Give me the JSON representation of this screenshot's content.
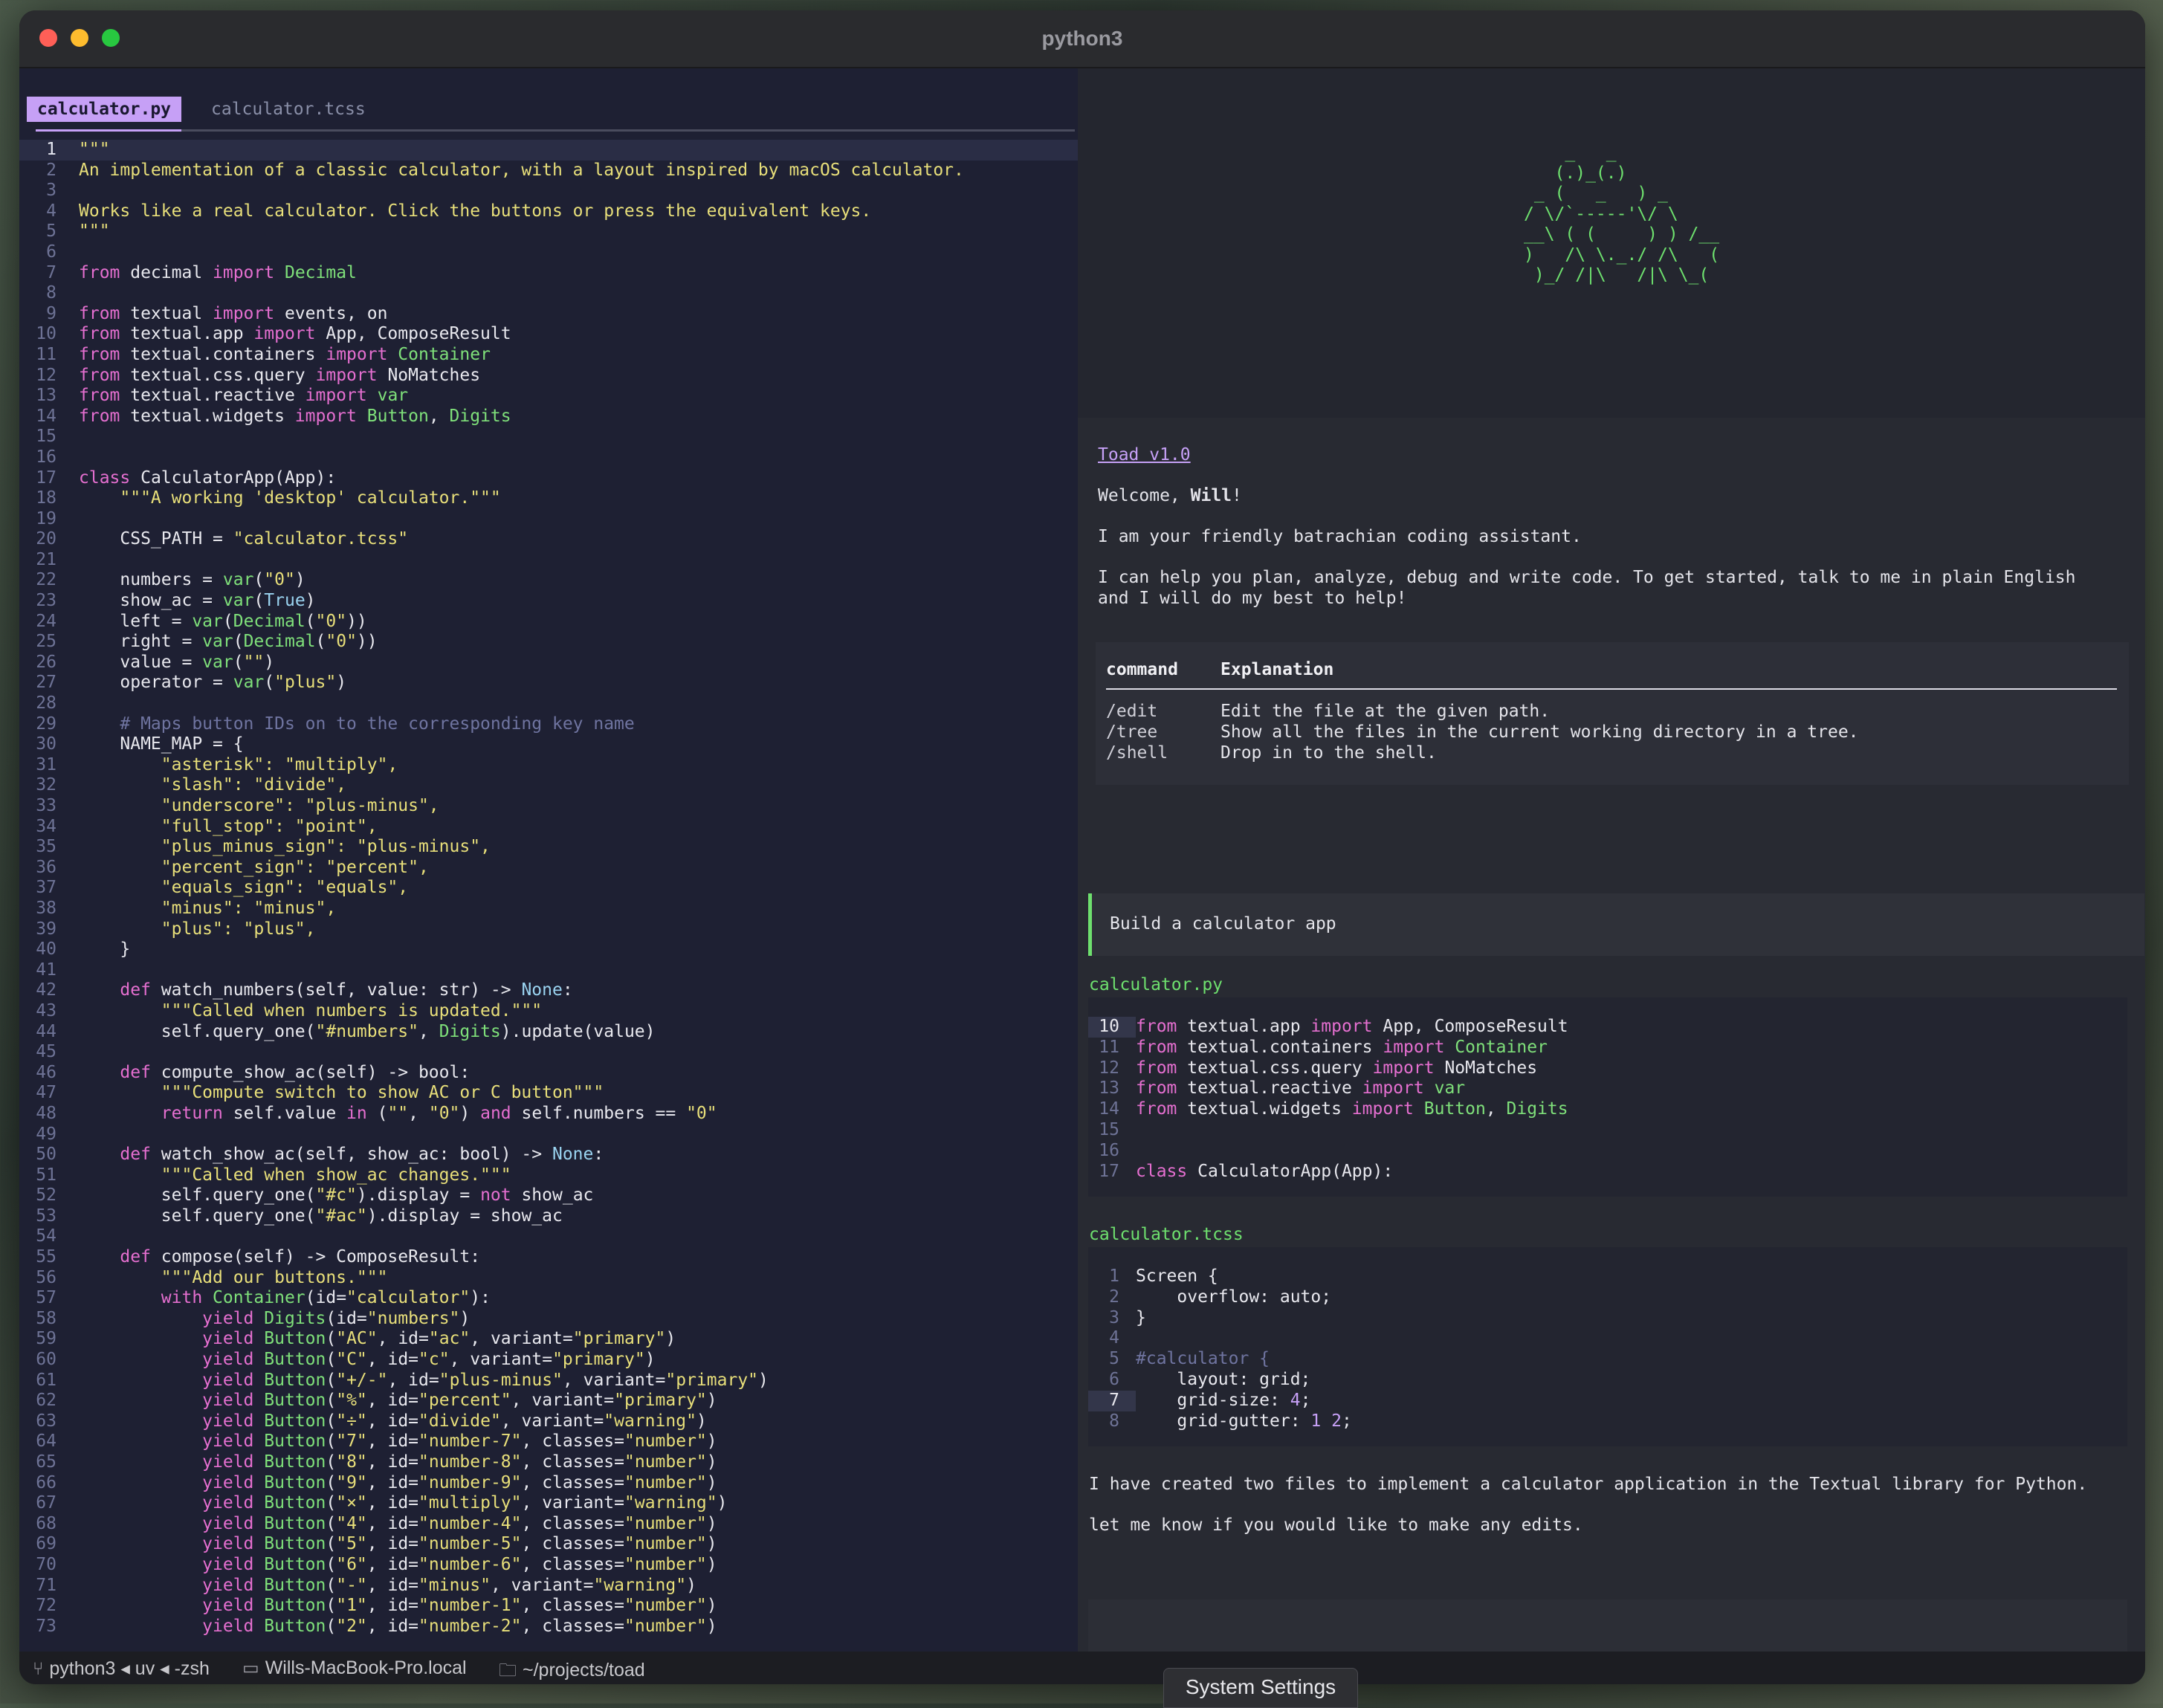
{
  "window": {
    "title": "python3"
  },
  "editor": {
    "tabs": [
      {
        "label": "calculator.py",
        "active": true
      },
      {
        "label": "calculator.tcss",
        "active": false
      }
    ],
    "lines": [
      {
        "n": "1",
        "t": "\"\"\"",
        "cls": "s"
      },
      {
        "n": "2",
        "t": "An implementation of a classic calculator, with a layout inspired by macOS calculator.",
        "cls": "s"
      },
      {
        "n": "3",
        "t": "",
        "cls": "s"
      },
      {
        "n": "4",
        "t": "Works like a real calculator. Click the buttons or press the equivalent keys.",
        "cls": "s"
      },
      {
        "n": "5",
        "t": "\"\"\"",
        "cls": "s"
      },
      {
        "n": "6",
        "t": "",
        "cls": ""
      },
      {
        "n": "7",
        "t": "from decimal import Decimal",
        "cls": "imp"
      },
      {
        "n": "8",
        "t": "",
        "cls": ""
      },
      {
        "n": "9",
        "t": "from textual import events, on",
        "cls": "imp"
      },
      {
        "n": "10",
        "t": "from textual.app import App, ComposeResult",
        "cls": "imp"
      },
      {
        "n": "11",
        "t": "from textual.containers import Container",
        "cls": "imp"
      },
      {
        "n": "12",
        "t": "from textual.css.query import NoMatches",
        "cls": "imp"
      },
      {
        "n": "13",
        "t": "from textual.reactive import var",
        "cls": "imp"
      },
      {
        "n": "14",
        "t": "from textual.widgets import Button, Digits",
        "cls": "imp"
      },
      {
        "n": "15",
        "t": "",
        "cls": ""
      },
      {
        "n": "16",
        "t": "",
        "cls": ""
      },
      {
        "n": "17",
        "t": "class CalculatorApp(App):",
        "cls": ""
      },
      {
        "n": "18",
        "t": "    \"\"\"A working 'desktop' calculator.\"\"\"",
        "cls": "s"
      },
      {
        "n": "19",
        "t": "",
        "cls": ""
      },
      {
        "n": "20",
        "t": "    CSS_PATH = \"calculator.tcss\"",
        "cls": ""
      },
      {
        "n": "21",
        "t": "",
        "cls": ""
      },
      {
        "n": "22",
        "t": "    numbers = var(\"0\")",
        "cls": ""
      },
      {
        "n": "23",
        "t": "    show_ac = var(True)",
        "cls": ""
      },
      {
        "n": "24",
        "t": "    left = var(Decimal(\"0\"))",
        "cls": ""
      },
      {
        "n": "25",
        "t": "    right = var(Decimal(\"0\"))",
        "cls": ""
      },
      {
        "n": "26",
        "t": "    value = var(\"\")",
        "cls": ""
      },
      {
        "n": "27",
        "t": "    operator = var(\"plus\")",
        "cls": ""
      },
      {
        "n": "28",
        "t": "",
        "cls": ""
      },
      {
        "n": "29",
        "t": "    # Maps button IDs on to the corresponding key name",
        "cls": "c"
      },
      {
        "n": "30",
        "t": "    NAME_MAP = {",
        "cls": ""
      },
      {
        "n": "31",
        "t": "        \"asterisk\": \"multiply\",",
        "cls": "s"
      },
      {
        "n": "32",
        "t": "        \"slash\": \"divide\",",
        "cls": "s"
      },
      {
        "n": "33",
        "t": "        \"underscore\": \"plus-minus\",",
        "cls": "s"
      },
      {
        "n": "34",
        "t": "        \"full_stop\": \"point\",",
        "cls": "s"
      },
      {
        "n": "35",
        "t": "        \"plus_minus_sign\": \"plus-minus\",",
        "cls": "s"
      },
      {
        "n": "36",
        "t": "        \"percent_sign\": \"percent\",",
        "cls": "s"
      },
      {
        "n": "37",
        "t": "        \"equals_sign\": \"equals\",",
        "cls": "s"
      },
      {
        "n": "38",
        "t": "        \"minus\": \"minus\",",
        "cls": "s"
      },
      {
        "n": "39",
        "t": "        \"plus\": \"plus\",",
        "cls": "s"
      },
      {
        "n": "40",
        "t": "    }",
        "cls": ""
      },
      {
        "n": "41",
        "t": "",
        "cls": ""
      },
      {
        "n": "42",
        "t": "    def watch_numbers(self, value: str) -> None:",
        "cls": "def"
      },
      {
        "n": "43",
        "t": "        \"\"\"Called when numbers is updated.\"\"\"",
        "cls": "s"
      },
      {
        "n": "44",
        "t": "        self.query_one(\"#numbers\", Digits).update(value)",
        "cls": ""
      },
      {
        "n": "45",
        "t": "",
        "cls": ""
      },
      {
        "n": "46",
        "t": "    def compute_show_ac(self) -> bool:",
        "cls": "def"
      },
      {
        "n": "47",
        "t": "        \"\"\"Compute switch to show AC or C button\"\"\"",
        "cls": "s"
      },
      {
        "n": "48",
        "t": "        return self.value in (\"\", \"0\") and self.numbers == \"0\"",
        "cls": ""
      },
      {
        "n": "49",
        "t": "",
        "cls": ""
      },
      {
        "n": "50",
        "t": "    def watch_show_ac(self, show_ac: bool) -> None:",
        "cls": "def"
      },
      {
        "n": "51",
        "t": "        \"\"\"Called when show_ac changes.\"\"\"",
        "cls": "s"
      },
      {
        "n": "52",
        "t": "        self.query_one(\"#c\").display = not show_ac",
        "cls": ""
      },
      {
        "n": "53",
        "t": "        self.query_one(\"#ac\").display = show_ac",
        "cls": ""
      },
      {
        "n": "54",
        "t": "",
        "cls": ""
      },
      {
        "n": "55",
        "t": "    def compose(self) -> ComposeResult:",
        "cls": "def"
      },
      {
        "n": "56",
        "t": "        \"\"\"Add our buttons.\"\"\"",
        "cls": "s"
      },
      {
        "n": "57",
        "t": "        with Container(id=\"calculator\"):",
        "cls": ""
      },
      {
        "n": "58",
        "t": "            yield Digits(id=\"numbers\")",
        "cls": ""
      },
      {
        "n": "59",
        "t": "            yield Button(\"AC\", id=\"ac\", variant=\"primary\")",
        "cls": ""
      },
      {
        "n": "60",
        "t": "            yield Button(\"C\", id=\"c\", variant=\"primary\")",
        "cls": ""
      },
      {
        "n": "61",
        "t": "            yield Button(\"+/-\", id=\"plus-minus\", variant=\"primary\")",
        "cls": ""
      },
      {
        "n": "62",
        "t": "            yield Button(\"%\", id=\"percent\", variant=\"primary\")",
        "cls": ""
      },
      {
        "n": "63",
        "t": "            yield Button(\"÷\", id=\"divide\", variant=\"warning\")",
        "cls": ""
      },
      {
        "n": "64",
        "t": "            yield Button(\"7\", id=\"number-7\", classes=\"number\")",
        "cls": ""
      },
      {
        "n": "65",
        "t": "            yield Button(\"8\", id=\"number-8\", classes=\"number\")",
        "cls": ""
      },
      {
        "n": "66",
        "t": "            yield Button(\"9\", id=\"number-9\", classes=\"number\")",
        "cls": ""
      },
      {
        "n": "67",
        "t": "            yield Button(\"×\", id=\"multiply\", variant=\"warning\")",
        "cls": ""
      },
      {
        "n": "68",
        "t": "            yield Button(\"4\", id=\"number-4\", classes=\"number\")",
        "cls": ""
      },
      {
        "n": "69",
        "t": "            yield Button(\"5\", id=\"number-5\", classes=\"number\")",
        "cls": ""
      },
      {
        "n": "70",
        "t": "            yield Button(\"6\", id=\"number-6\", classes=\"number\")",
        "cls": ""
      },
      {
        "n": "71",
        "t": "            yield Button(\"-\", id=\"minus\", variant=\"warning\")",
        "cls": ""
      },
      {
        "n": "72",
        "t": "            yield Button(\"1\", id=\"number-1\", classes=\"number\")",
        "cls": ""
      },
      {
        "n": "73",
        "t": "            yield Button(\"2\", id=\"number-2\", classes=\"number\")",
        "cls": ""
      }
    ]
  },
  "chat": {
    "ascii_art": "    _   _\n   (.)_(.)\n _ (   _   ) _\n/ \\/`-----'\\/ \\\n__\\ ( (     ) ) /__\n)   /\\ \\._./ /\\   (\n )_/ /|\\   /|\\ \\_(",
    "version_link": "Toad v1.0",
    "welcome_prefix": "Welcome, ",
    "welcome_name": "Will",
    "welcome_suffix": "!",
    "intro1": "I am your friendly batrachian coding assistant.",
    "intro2a": "I can help you plan, analyze, debug and write code. To get started, talk to me in plain English",
    "intro2b": "and I will do my best to help!",
    "table": {
      "col1": "command",
      "col2": "Explanation",
      "rows": [
        {
          "cmd": "/edit",
          "desc": "Edit the file at the given path."
        },
        {
          "cmd": "/tree",
          "desc": "Show all the files in the current working directory in a tree."
        },
        {
          "cmd": "/shell",
          "desc": "Drop in to the shell."
        }
      ]
    },
    "user_prompt": "Build a calculator app",
    "file1": {
      "name": "calculator.py",
      "lines": [
        {
          "n": "10",
          "t": "from textual.app import App, ComposeResult"
        },
        {
          "n": "11",
          "t": "from textual.containers import Container"
        },
        {
          "n": "12",
          "t": "from textual.css.query import NoMatches"
        },
        {
          "n": "13",
          "t": "from textual.reactive import var"
        },
        {
          "n": "14",
          "t": "from textual.widgets import Button, Digits"
        },
        {
          "n": "15",
          "t": ""
        },
        {
          "n": "16",
          "t": ""
        },
        {
          "n": "17",
          "t": "class CalculatorApp(App):"
        }
      ]
    },
    "file2": {
      "name": "calculator.tcss",
      "lines": [
        {
          "n": "1",
          "t": "Screen {"
        },
        {
          "n": "2",
          "t": "    overflow: auto;"
        },
        {
          "n": "3",
          "t": "}"
        },
        {
          "n": "4",
          "t": ""
        },
        {
          "n": "5",
          "t": "#calculator {"
        },
        {
          "n": "6",
          "t": "    layout: grid;"
        },
        {
          "n": "7",
          "t": "    grid-size: 4;"
        },
        {
          "n": "8",
          "t": "    grid-gutter: 1 2;"
        }
      ]
    },
    "reply1": "I have created two files to implement a calculator application in the Textual library for Python.",
    "reply2": "let me know if you would like to make any edits."
  },
  "statusbar": {
    "process": "python3 ◂ uv ◂ -zsh",
    "host": "Wills-MacBook-Pro.local",
    "path": "~/projects/toad"
  },
  "dock_tooltip": "System Settings",
  "colors": {
    "accent": "#c6a0f6",
    "green": "#6ee06e",
    "keyword": "#e56fd0",
    "string": "#e8df7a"
  }
}
